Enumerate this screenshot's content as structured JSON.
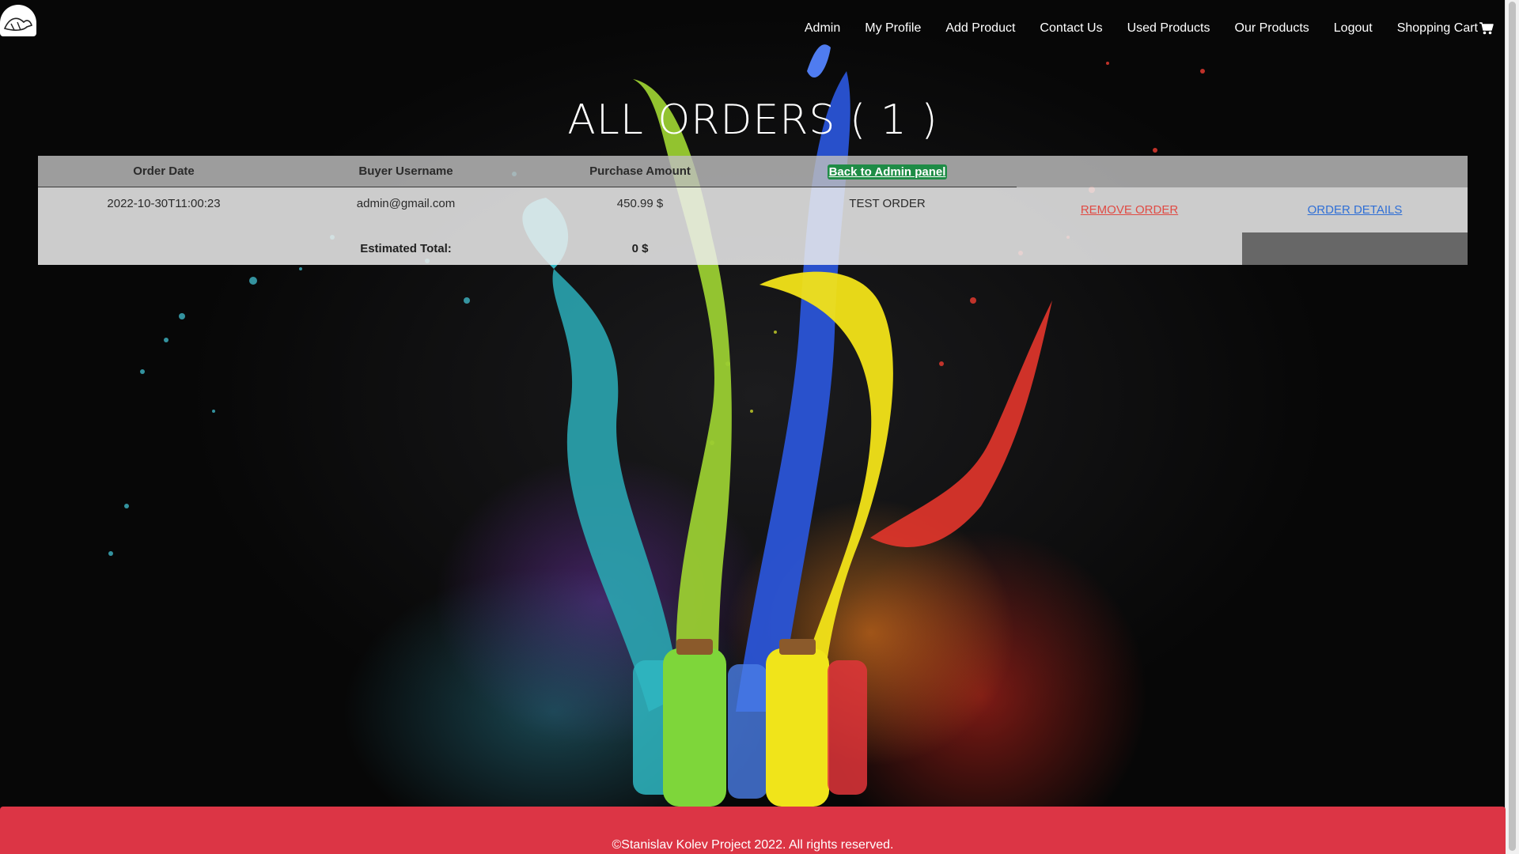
{
  "nav": {
    "logo_icon": "bird-logo-icon",
    "links": {
      "admin": "Admin",
      "profile": "My Profile",
      "add_product": "Add Product",
      "contact": "Contact Us",
      "used_products": "Used Products",
      "our_products": "Our Products",
      "logout": "Logout",
      "cart": "Shopping Cart"
    },
    "cart_icon": "shopping-cart-icon"
  },
  "page": {
    "title": "ALL ORDERS ( 1 )"
  },
  "table": {
    "headers": {
      "order_date": "Order Date",
      "buyer": "Buyer Username",
      "amount": "Purchase Amount",
      "back_link": "Back to Admin panel"
    },
    "rows": [
      {
        "order_date": "2022-10-30T11:00:23",
        "buyer": "admin@gmail.com",
        "amount": "450.99 $",
        "note": "TEST ORDER",
        "remove": "REMOVE ORDER",
        "details": "ORDER DETAILS"
      }
    ],
    "total": {
      "label": "Estimated Total:",
      "value": "0 $"
    }
  },
  "footer": {
    "text": "©Stanislav Kolev Project 2022. All rights reserved."
  },
  "colors": {
    "footer_bg": "#dc3545",
    "back_link_bg": "#1e8c46",
    "remove_link": "#e04b44",
    "details_link": "#2f6fd6"
  }
}
